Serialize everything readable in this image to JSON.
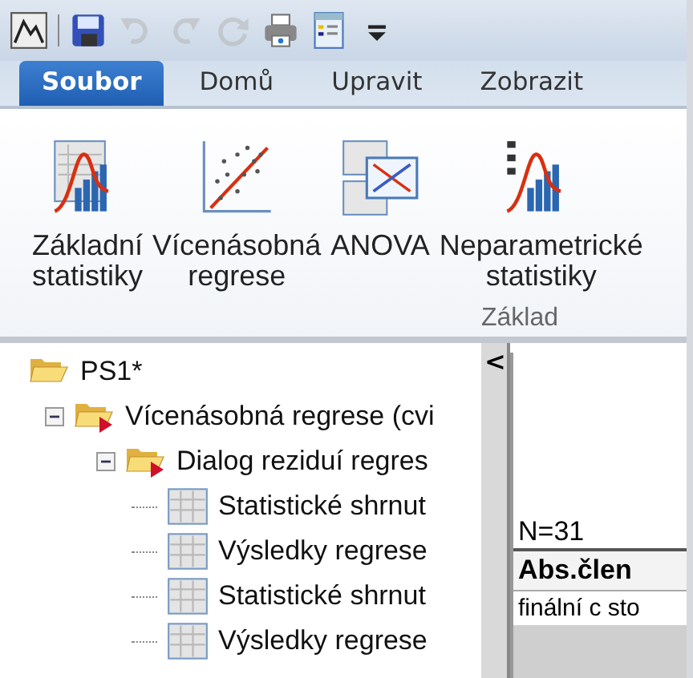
{
  "quick_access": [
    {
      "kind": "app",
      "disabled": false
    },
    {
      "kind": "save",
      "disabled": false
    },
    {
      "kind": "undo",
      "disabled": true
    },
    {
      "kind": "redo",
      "disabled": true
    },
    {
      "kind": "refresh",
      "disabled": true
    },
    {
      "kind": "print",
      "disabled": false
    },
    {
      "kind": "form",
      "disabled": false
    },
    {
      "kind": "more",
      "disabled": false
    }
  ],
  "tabs": [
    {
      "label": "Soubor",
      "selected": true
    },
    {
      "label": "Domů",
      "selected": false
    },
    {
      "label": "Upravit",
      "selected": false
    },
    {
      "label": "Zobrazit",
      "selected": false
    }
  ],
  "ribbon": {
    "group": "Základ",
    "buttons": [
      {
        "kind": "basic",
        "lines": [
          "Základní",
          "statistiky"
        ]
      },
      {
        "kind": "scatter",
        "lines": [
          "Vícenásobná",
          "regrese"
        ]
      },
      {
        "kind": "anova",
        "lines": [
          "ANOVA"
        ]
      },
      {
        "kind": "nonparam",
        "lines": [
          "Neparametrické",
          "statistiky"
        ]
      }
    ]
  },
  "tree": [
    {
      "label": "PS1*",
      "kind": "root",
      "expanded": true,
      "children": [
        {
          "label": "Vícenásobná regrese (cvi",
          "kind": "analysis",
          "expanded": true,
          "children": [
            {
              "label": "Dialog reziduí regres",
              "kind": "analysis",
              "expanded": true,
              "children": [
                {
                  "label": "Statistické shrnut",
                  "kind": "sheet"
                },
                {
                  "label": "Výsledky regrese",
                  "kind": "sheet"
                },
                {
                  "label": "Statistické shrnut",
                  "kind": "sheet"
                },
                {
                  "label": "Výsledky regrese",
                  "kind": "sheet"
                }
              ]
            }
          ]
        }
      ]
    }
  ],
  "splitter": {
    "label": "<"
  },
  "sheet": {
    "note": "N=31",
    "header": "Abs.člen",
    "cell": "finální c sto"
  }
}
